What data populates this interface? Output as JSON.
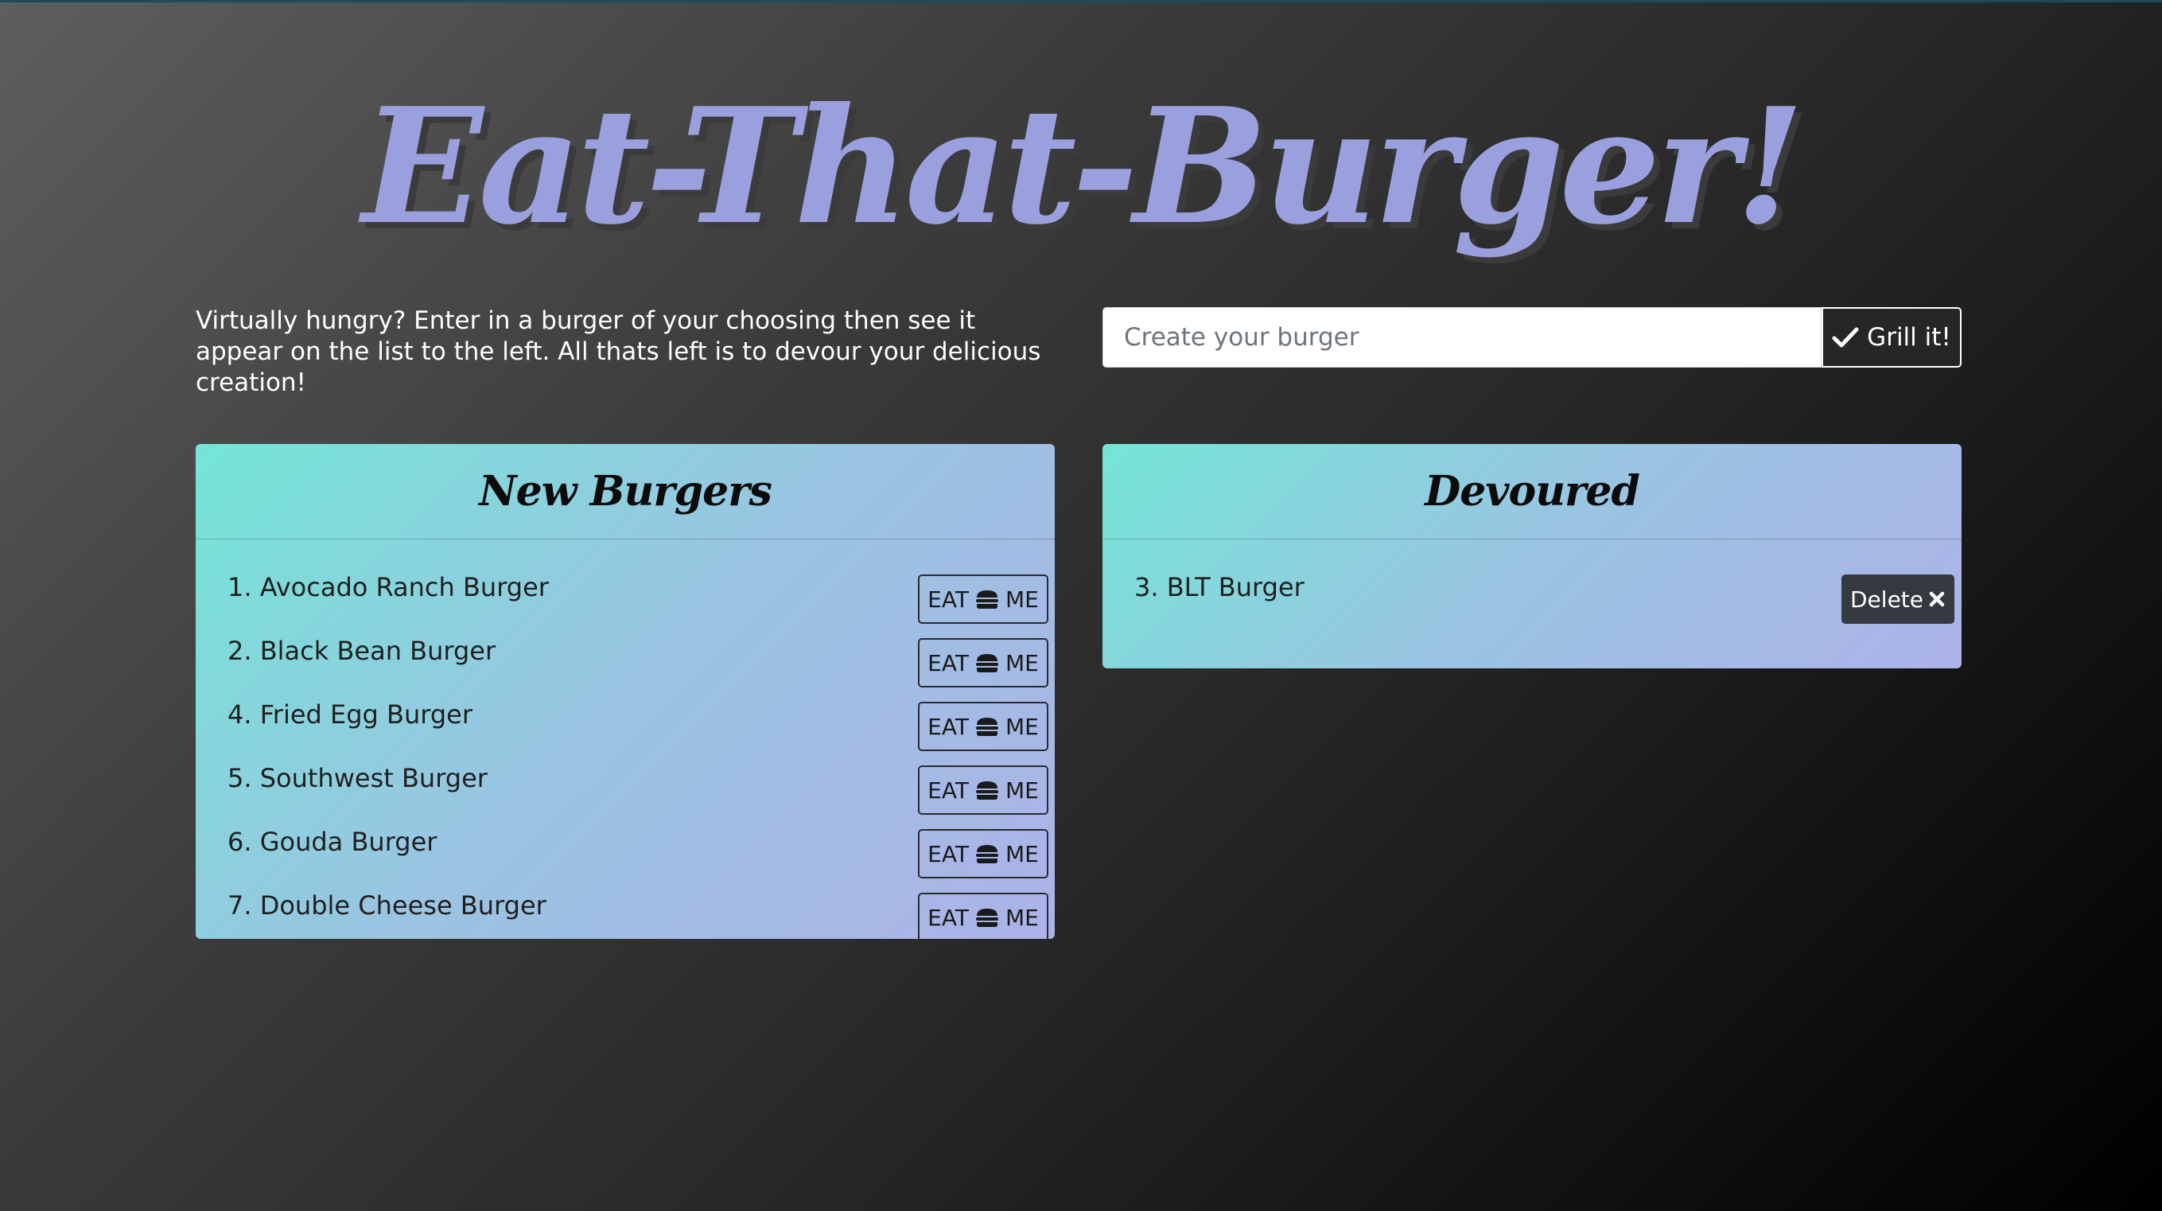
{
  "app": {
    "title": "Eat-That-Burger!"
  },
  "intro": {
    "text": "Virtually hungry? Enter in a burger of your choosing then see it appear on the list to the left. All thats left is to devour your delicious creation!"
  },
  "form": {
    "placeholder": "Create your burger",
    "value": "",
    "submit_label": "Grill it!",
    "submit_icon": "check-icon"
  },
  "new_burgers": {
    "heading": "New Burgers",
    "button_label_left": "EAT",
    "button_label_right": "ME",
    "button_icon": "burger-icon",
    "items": [
      {
        "label": "1. Avocado Ranch Burger"
      },
      {
        "label": "2. Black Bean Burger"
      },
      {
        "label": "4. Fried Egg Burger"
      },
      {
        "label": "5. Southwest Burger"
      },
      {
        "label": "6. Gouda Burger"
      },
      {
        "label": "7. Double Cheese Burger"
      }
    ]
  },
  "devoured": {
    "heading": "Devoured",
    "delete_label": "Delete",
    "delete_icon": "close-icon",
    "items": [
      {
        "label": "3. BLT Burger"
      }
    ]
  },
  "colors": {
    "title": "#9aa0dd",
    "card_gradient_start": "#74e5d6",
    "card_gradient_end": "#adb2e8",
    "delete_button": "#343a40",
    "grill_button": "#262626"
  }
}
